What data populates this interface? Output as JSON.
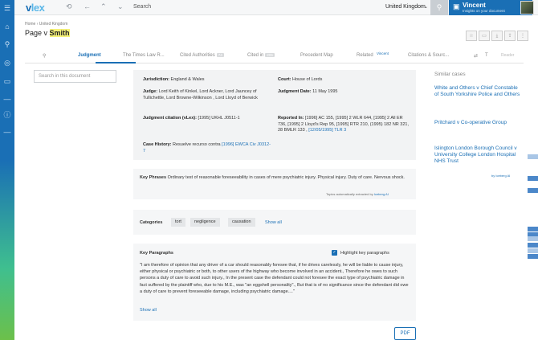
{
  "app": {
    "logo_main": "v",
    "logo_accent": "lex",
    "search_placeholder": "Search",
    "country": "United Kingdom",
    "user_name": "Vincent",
    "user_sub": "Insights on your document"
  },
  "breadcrumb": "Home › United Kingdom",
  "page_title_prefix": "Page v ",
  "page_title_highlight": "Smith",
  "tabs": {
    "judgment": "Judgment",
    "times": "The Times Law R...",
    "cited_auth": "Cited Authorities",
    "cited_auth_count": "74",
    "cited_in": "Cited in",
    "cited_in_count": "206",
    "precedent": "Precedent Map",
    "related": "Related",
    "vincent_tag": "Vincent",
    "citations": "Citations & Sourc...",
    "reader": "Reader"
  },
  "doc_search_placeholder": "Search in this document",
  "meta": {
    "jurisdiction_label": "Jurisdiction:",
    "jurisdiction": "England & Wales",
    "court_label": "Court:",
    "court": "House of Lords",
    "judge_label": "Judge:",
    "judge": "Lord Keith of Kinkel, Lord Ackner, Lord Jauncey of Tullichettle, Lord Browne-Wilkinson , Lord Lloyd of Berwick",
    "date_label": "Judgment Date:",
    "date": "11 May 1995",
    "citation_label": "Judgment citation (vLex):",
    "citation": "[1995] UKHL J0511-1",
    "reported_label": "Reported In:",
    "reported": "[1996] AC 155, [1995] 2 WLR 644, [1995] 2 All ER 736, [1995] 2 Lloyd's Rep 95, [1995] RTR 210, (1995) 182 NR 321, 28 BMLR 133 ,",
    "reported_link": "[12/05/1995] TLR 3",
    "history_label": "Case History:",
    "history": "Resuelve recurso contra",
    "history_link": "[1996] EWCA Civ J0312-7"
  },
  "key_phrases": {
    "label": "Key Phrases",
    "text": "Ordinary test of reasonable foreseeability in cases of mere psychiatric injury. Physical injury. Duty of care. Nervous shock.",
    "footer": "Topics automatically extracted by",
    "footer_link": "Iceberg AI"
  },
  "categories": {
    "label": "Categories",
    "items": [
      "tort",
      "negligence",
      "causation"
    ],
    "show_all": "Show all"
  },
  "key_paragraphs": {
    "label": "Key Paragraphs",
    "highlight_label": "Highlight key paragraphs",
    "text": "\"I am therefore of opinion that any driver of a car should reasonably foresee that, if he drives carelessly, he will be liable to cause injury, either physical or psychiatric or both, to other users of the highway who become involved in an accident., Therefore he owes to such persons a duty of care to avoid such injury., In the present case the defendant could not foresee the exact type of psychiatric damage in fact suffered by the plaintiff who, due to his M.E., was \"an eggshell personality\"., But that is of no significance since the defendant did owe a duty of care to prevent foreseeable damage, including psychiatric damage....\"",
    "show_all": "Show all"
  },
  "pdf_label": "PDF",
  "similar": {
    "title": "Similar cases",
    "items": [
      "White and Others v Chief Constable of South Yorkshire Police and Others",
      "Pritchard v Co-operative Group",
      "Islington London Borough Council v University College London Hospital NHS Trust"
    ],
    "powered": "by Iceberg AI"
  },
  "colors": {
    "brand": "#1a6fb5",
    "highlight": "#f5f179"
  },
  "icons": [
    "menu-icon",
    "home-icon",
    "search-icon",
    "compass-icon",
    "message-icon",
    "history-icon",
    "back-icon",
    "forward-icon",
    "chevron-down-icon",
    "user-icon"
  ]
}
